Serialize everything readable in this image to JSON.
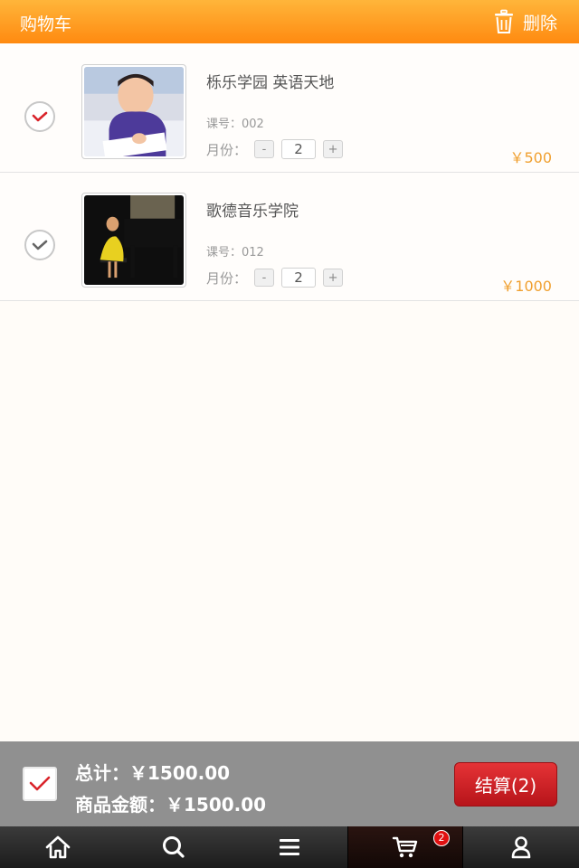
{
  "header": {
    "title": "购物车",
    "delete_label": "删除"
  },
  "cart_items": [
    {
      "name": "栎乐学园 英语天地",
      "course_code": "课号：002",
      "month_label": "月份：",
      "minus": "-",
      "quantity": "2",
      "plus": "+",
      "price": "￥500",
      "checked": true
    },
    {
      "name": "歌德音乐学院",
      "course_code": "课号：012",
      "month_label": "月份：",
      "minus": "-",
      "quantity": "2",
      "plus": "+",
      "price": "￥1000",
      "checked": false
    }
  ],
  "summary": {
    "total": "总计：￥1500.00",
    "amount": "商品金额：￥1500.00",
    "checkout_label": "结算(2)"
  },
  "tabbar": {
    "cart_badge": "2",
    "icons": [
      "home-icon",
      "search-icon",
      "menu-icon",
      "cart-icon",
      "user-icon"
    ],
    "active": "cart"
  },
  "colors": {
    "header": "#ff9a1f",
    "price": "#f0a030",
    "check_red": "#d9232a",
    "checkout": "#cc1d22"
  }
}
